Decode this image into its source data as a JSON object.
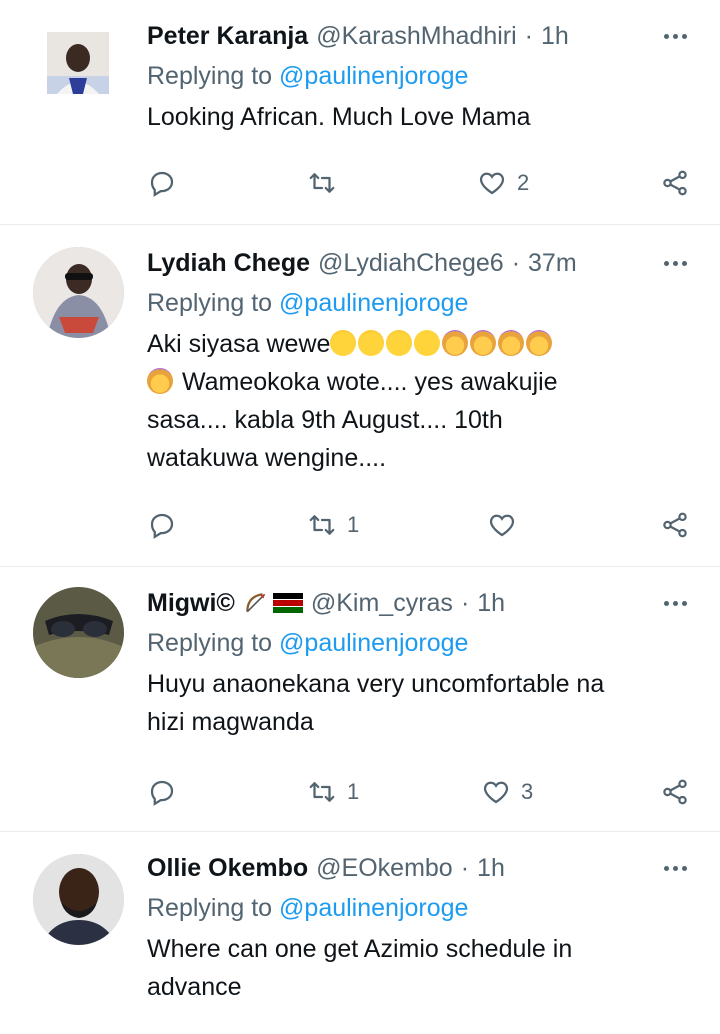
{
  "tweets": [
    {
      "name": "Peter Karanja",
      "handle": "@KarashMhadhiri",
      "time": "1h",
      "replying_prefix": "Replying to",
      "replying_handle": "@paulinenjoroge",
      "lines": [
        "Looking African. Much Love Mama"
      ],
      "retweets": "",
      "likes": "2"
    },
    {
      "name": "Lydiah Chege",
      "handle": "@LydiahChege6",
      "time": "37m",
      "replying_prefix": "Replying to",
      "replying_handle": "@paulinenjoroge",
      "line1": "Aki siyasa wewe",
      "lines": [
        "Wameokoka wote.... yes awakujie",
        "sasa.... kabla 9th August.... 10th",
        "watakuwa wengine...."
      ],
      "retweets": "1",
      "likes": ""
    },
    {
      "name": "Migwi©",
      "handle": "@Kim_cyras",
      "time": "1h",
      "replying_prefix": "Replying to",
      "replying_handle": "@paulinenjoroge",
      "lines": [
        "Huyu anaonekana very uncomfortable na",
        "hizi magwanda"
      ],
      "retweets": "1",
      "likes": "3"
    },
    {
      "name": "Ollie Okembo",
      "handle": "@EOkembo",
      "time": "1h",
      "replying_prefix": "Replying to",
      "replying_handle": "@paulinenjoroge",
      "lines": [
        "Where can one get Azimio schedule in",
        "advance"
      ],
      "retweets": "",
      "likes": ""
    }
  ],
  "icons": {
    "reply": "reply-icon",
    "retweet": "retweet-icon",
    "like": "heart-icon",
    "share": "share-icon",
    "more": "more-icon"
  },
  "colors": {
    "link": "#1d9bf0",
    "secondary": "#536471",
    "divider": "#e6ecf0"
  }
}
